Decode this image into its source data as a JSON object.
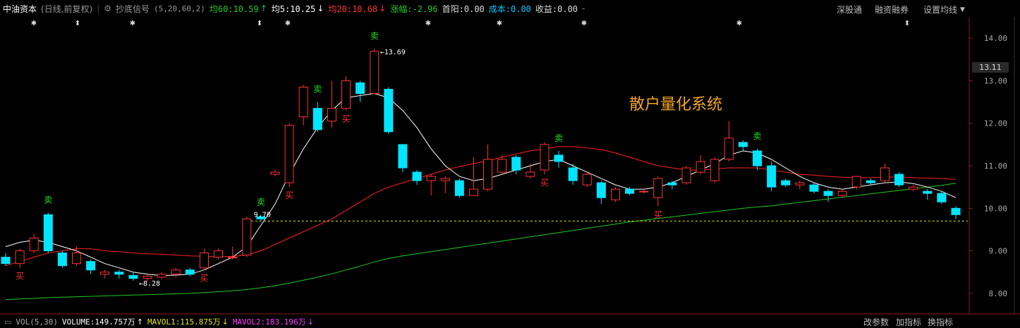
{
  "header": {
    "stock_name": "中油资本",
    "period": "(日线,前复权)",
    "indicator_name": "抄底信号",
    "indicator_params": "(5,20,60,2)",
    "ma60_label": "均60:10.59",
    "ma5_label": "均5:10.25",
    "ma20_label": "均20:10.68",
    "change_label": "涨幅:-2.96",
    "first_sun_label": "首阳:0.00",
    "cost_label": "成本:0.00",
    "profit_label": "收益:0.00",
    "btn_shen": "深股通",
    "btn_rong": "融资融券",
    "btn_ma": "设置均线"
  },
  "volume_bar": {
    "vol_label": "VOL(5,30)",
    "volume": "VOLUME:149.757万",
    "mavol1": "MAVOL1:115.875万",
    "mavol2": "MAVOL2:183.196万",
    "btn_params": "改参数",
    "btn_add": "加指标",
    "btn_switch": "换指标"
  },
  "watermark": "散户量化系统",
  "current_price_tag": "13.11",
  "colors": {
    "up": "#ff3232",
    "down": "#00e5ff",
    "ma5": "#ffffff",
    "ma20": "#ff2020",
    "ma60": "#22c922",
    "support": "#e8e800",
    "sell": "#20e020",
    "buy": "#ff3232"
  },
  "chart_data": {
    "type": "candlestick",
    "ylim": [
      7.6,
      14.5
    ],
    "yticks": [
      "14.00",
      "13.00",
      "12.00",
      "11.00",
      "10.00",
      "9.00",
      "8.00"
    ],
    "support_line": 9.7,
    "annotations": {
      "high": "13.69",
      "low": "8.28",
      "mark": "9.70"
    },
    "signal_text": {
      "sell": "卖",
      "buy": "买"
    },
    "sell_signals": [
      3,
      18,
      22,
      26,
      39,
      53
    ],
    "buy_signals": [
      1,
      14,
      20,
      24,
      38,
      46
    ],
    "candles": [
      [
        8.85,
        8.7,
        8.95,
        8.65
      ],
      [
        8.7,
        9.0,
        9.05,
        8.6
      ],
      [
        9.0,
        9.3,
        9.4,
        8.95
      ],
      [
        9.85,
        9.0,
        9.9,
        8.95
      ],
      [
        8.95,
        8.65,
        9.0,
        8.6
      ],
      [
        8.7,
        8.95,
        9.1,
        8.65
      ],
      [
        8.75,
        8.55,
        8.8,
        8.45
      ],
      [
        8.45,
        8.5,
        8.55,
        8.35
      ],
      [
        8.5,
        8.45,
        8.55,
        8.35
      ],
      [
        8.42,
        8.35,
        8.5,
        8.3
      ],
      [
        8.35,
        8.4,
        8.45,
        8.28
      ],
      [
        8.38,
        8.45,
        8.5,
        8.33
      ],
      [
        8.45,
        8.55,
        8.6,
        8.38
      ],
      [
        8.55,
        8.45,
        8.6,
        8.4
      ],
      [
        8.6,
        8.95,
        9.05,
        8.55
      ],
      [
        8.85,
        9.0,
        9.05,
        8.8
      ],
      [
        8.85,
        8.85,
        9.1,
        8.8
      ],
      [
        8.9,
        9.75,
        9.8,
        8.85
      ],
      [
        9.8,
        9.75,
        9.85,
        9.7
      ],
      [
        10.8,
        10.85,
        10.9,
        10.75
      ],
      [
        10.6,
        11.95,
        12.0,
        10.5
      ],
      [
        12.15,
        12.85,
        12.9,
        11.95
      ],
      [
        12.35,
        11.85,
        12.5,
        11.8
      ],
      [
        12.05,
        12.35,
        13.0,
        11.9
      ],
      [
        12.35,
        13.0,
        13.1,
        12.3
      ],
      [
        12.95,
        12.7,
        13.0,
        12.5
      ],
      [
        12.7,
        13.69,
        13.75,
        12.7
      ],
      [
        12.8,
        11.8,
        12.85,
        11.75
      ],
      [
        11.5,
        10.95,
        11.5,
        10.85
      ],
      [
        10.85,
        10.65,
        10.9,
        10.55
      ],
      [
        10.65,
        10.75,
        10.8,
        10.3
      ],
      [
        10.65,
        10.7,
        10.75,
        10.35
      ],
      [
        10.65,
        10.3,
        10.7,
        10.25
      ],
      [
        10.3,
        10.45,
        11.2,
        10.3
      ],
      [
        10.45,
        11.15,
        11.5,
        10.4
      ],
      [
        10.85,
        11.15,
        11.25,
        10.8
      ],
      [
        11.2,
        10.9,
        11.25,
        10.8
      ],
      [
        10.75,
        10.85,
        11.05,
        10.7
      ],
      [
        10.9,
        11.5,
        11.55,
        10.8
      ],
      [
        11.25,
        11.1,
        11.35,
        10.95
      ],
      [
        10.95,
        10.65,
        11.05,
        10.55
      ],
      [
        10.55,
        10.8,
        10.85,
        10.5
      ],
      [
        10.6,
        10.25,
        10.65,
        10.1
      ],
      [
        10.2,
        10.45,
        10.5,
        10.15
      ],
      [
        10.45,
        10.35,
        10.5,
        10.3
      ],
      [
        10.4,
        10.4,
        10.45,
        10.35
      ],
      [
        10.25,
        10.7,
        10.75,
        10.05
      ],
      [
        10.6,
        10.55,
        10.65,
        10.45
      ],
      [
        10.6,
        10.95,
        11.0,
        10.55
      ],
      [
        10.85,
        11.1,
        11.25,
        10.8
      ],
      [
        10.65,
        11.15,
        11.2,
        10.6
      ],
      [
        11.15,
        11.65,
        12.05,
        11.1
      ],
      [
        11.55,
        11.45,
        11.6,
        11.35
      ],
      [
        11.35,
        11.0,
        11.4,
        10.9
      ],
      [
        11.0,
        10.5,
        11.1,
        10.4
      ],
      [
        10.65,
        10.55,
        10.7,
        10.5
      ],
      [
        10.55,
        10.6,
        10.65,
        10.45
      ],
      [
        10.55,
        10.4,
        10.6,
        10.35
      ],
      [
        10.4,
        10.3,
        10.45,
        10.15
      ],
      [
        10.3,
        10.4,
        10.45,
        10.25
      ],
      [
        10.5,
        10.75,
        10.75,
        10.45
      ],
      [
        10.65,
        10.6,
        10.7,
        10.55
      ],
      [
        10.65,
        10.95,
        11.05,
        10.6
      ],
      [
        10.8,
        10.55,
        10.85,
        10.5
      ],
      [
        10.45,
        10.5,
        10.55,
        10.4
      ],
      [
        10.4,
        10.35,
        10.45,
        10.2
      ],
      [
        10.35,
        10.15,
        10.4,
        10.1
      ],
      [
        10.0,
        9.85,
        10.05,
        9.75
      ]
    ],
    "ma5": [
      9.1,
      9.2,
      9.25,
      9.2,
      9.1,
      9.0,
      8.85,
      8.7,
      8.6,
      8.5,
      8.45,
      8.42,
      8.43,
      8.45,
      8.55,
      8.7,
      8.85,
      9.1,
      9.6,
      10.1,
      10.8,
      11.4,
      11.9,
      12.3,
      12.6,
      12.65,
      12.7,
      12.6,
      12.3,
      11.9,
      11.4,
      11.0,
      10.75,
      10.65,
      10.7,
      10.8,
      10.9,
      11.0,
      11.1,
      11.15,
      11.0,
      10.85,
      10.7,
      10.55,
      10.45,
      10.45,
      10.5,
      10.6,
      10.75,
      10.9,
      11.05,
      11.25,
      11.35,
      11.3,
      11.15,
      10.95,
      10.75,
      10.6,
      10.5,
      10.45,
      10.5,
      10.55,
      10.6,
      10.62,
      10.58,
      10.5,
      10.4,
      10.25
    ],
    "ma20": [
      8.65,
      8.75,
      8.85,
      8.95,
      9.0,
      9.05,
      9.05,
      9.0,
      8.98,
      8.95,
      8.93,
      8.92,
      8.9,
      8.88,
      8.87,
      8.86,
      8.87,
      8.9,
      9.0,
      9.15,
      9.3,
      9.45,
      9.6,
      9.75,
      9.95,
      10.15,
      10.35,
      10.5,
      10.6,
      10.7,
      10.8,
      10.9,
      10.98,
      11.05,
      11.12,
      11.2,
      11.28,
      11.35,
      11.4,
      11.45,
      11.45,
      11.42,
      11.38,
      11.3,
      11.2,
      11.1,
      11.0,
      10.95,
      10.9,
      10.9,
      10.92,
      10.95,
      10.95,
      10.95,
      10.9,
      10.85,
      10.8,
      10.78,
      10.75,
      10.73,
      10.72,
      10.72,
      10.73,
      10.74,
      10.72,
      10.71,
      10.7,
      10.68
    ],
    "ma60": [
      7.85,
      7.87,
      7.88,
      7.9,
      7.91,
      7.92,
      7.93,
      7.94,
      7.95,
      7.96,
      7.97,
      7.98,
      7.99,
      8.0,
      8.02,
      8.04,
      8.06,
      8.09,
      8.13,
      8.18,
      8.24,
      8.31,
      8.38,
      8.46,
      8.55,
      8.64,
      8.74,
      8.82,
      8.88,
      8.93,
      8.98,
      9.03,
      9.08,
      9.13,
      9.18,
      9.23,
      9.28,
      9.33,
      9.38,
      9.43,
      9.48,
      9.53,
      9.58,
      9.63,
      9.68,
      9.72,
      9.76,
      9.8,
      9.84,
      9.88,
      9.92,
      9.96,
      10.0,
      10.03,
      10.06,
      10.1,
      10.14,
      10.18,
      10.22,
      10.26,
      10.3,
      10.34,
      10.38,
      10.42,
      10.46,
      10.5,
      10.54,
      10.59
    ]
  }
}
